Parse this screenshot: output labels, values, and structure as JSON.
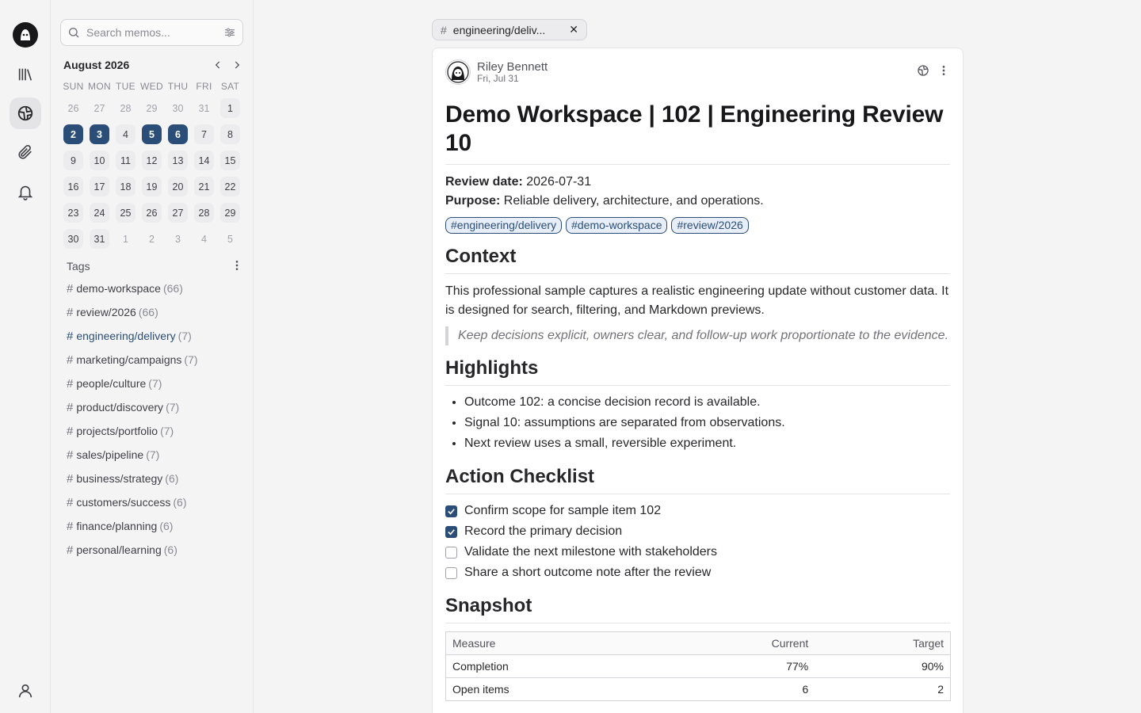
{
  "search": {
    "placeholder": "Search memos..."
  },
  "calendar": {
    "month_label": "August 2026",
    "weekdays": [
      "SUN",
      "MON",
      "TUE",
      "WED",
      "THU",
      "FRI",
      "SAT"
    ],
    "days": [
      {
        "d": "26",
        "muted": true
      },
      {
        "d": "27",
        "muted": true
      },
      {
        "d": "28",
        "muted": true
      },
      {
        "d": "29",
        "muted": true
      },
      {
        "d": "30",
        "muted": true
      },
      {
        "d": "31",
        "muted": true
      },
      {
        "d": "1",
        "bg": true
      },
      {
        "d": "2",
        "sel": true
      },
      {
        "d": "3",
        "sel": true
      },
      {
        "d": "4",
        "bg": true
      },
      {
        "d": "5",
        "sel": true
      },
      {
        "d": "6",
        "sel": true
      },
      {
        "d": "7",
        "bg": true
      },
      {
        "d": "8",
        "bg": true
      },
      {
        "d": "9",
        "bg": true
      },
      {
        "d": "10",
        "bg": true
      },
      {
        "d": "11",
        "bg": true
      },
      {
        "d": "12",
        "bg": true
      },
      {
        "d": "13",
        "bg": true
      },
      {
        "d": "14",
        "bg": true
      },
      {
        "d": "15",
        "bg": true
      },
      {
        "d": "16",
        "bg": true
      },
      {
        "d": "17",
        "bg": true
      },
      {
        "d": "18",
        "bg": true
      },
      {
        "d": "19",
        "bg": true
      },
      {
        "d": "20",
        "bg": true
      },
      {
        "d": "21",
        "bg": true
      },
      {
        "d": "22",
        "bg": true
      },
      {
        "d": "23",
        "bg": true
      },
      {
        "d": "24",
        "bg": true
      },
      {
        "d": "25",
        "bg": true
      },
      {
        "d": "26",
        "bg": true
      },
      {
        "d": "27",
        "bg": true
      },
      {
        "d": "28",
        "bg": true
      },
      {
        "d": "29",
        "bg": true
      },
      {
        "d": "30",
        "bg": true
      },
      {
        "d": "31",
        "bg": true
      },
      {
        "d": "1",
        "muted": true
      },
      {
        "d": "2",
        "muted": true
      },
      {
        "d": "3",
        "muted": true
      },
      {
        "d": "4",
        "muted": true
      },
      {
        "d": "5",
        "muted": true
      }
    ]
  },
  "tags": {
    "heading": "Tags",
    "items": [
      {
        "name": "demo-workspace",
        "count": "(66)"
      },
      {
        "name": "review/2026",
        "count": "(66)"
      },
      {
        "name": "engineering/delivery",
        "count": "(7)",
        "active": true
      },
      {
        "name": "marketing/campaigns",
        "count": "(7)"
      },
      {
        "name": "people/culture",
        "count": "(7)"
      },
      {
        "name": "product/discovery",
        "count": "(7)"
      },
      {
        "name": "projects/portfolio",
        "count": "(7)"
      },
      {
        "name": "sales/pipeline",
        "count": "(7)"
      },
      {
        "name": "business/strategy",
        "count": "(6)"
      },
      {
        "name": "customers/success",
        "count": "(6)"
      },
      {
        "name": "finance/planning",
        "count": "(6)"
      },
      {
        "name": "personal/learning",
        "count": "(6)"
      }
    ]
  },
  "filter": {
    "label": "engineering/deliv...",
    "close": "✕"
  },
  "memo": {
    "author": "Riley Bennett",
    "date": "Fri, Jul 31",
    "title": "Demo Workspace | 102 | Engineering Review 10",
    "review_label": "Review date:",
    "review_value": " 2026-07-31",
    "purpose_label": "Purpose:",
    "purpose_value": " Reliable delivery, architecture, and operations.",
    "tag_pills": [
      "#engineering/delivery",
      "#demo-workspace",
      "#review/2026"
    ],
    "context_heading": "Context",
    "context_text": "This professional sample captures a realistic engineering update without customer data. It is designed for search, filtering, and Markdown previews.",
    "quote": "Keep decisions explicit, owners clear, and follow-up work proportionate to the evidence.",
    "highlights_heading": "Highlights",
    "highlights": [
      "Outcome 102: a concise decision record is available.",
      "Signal 10: assumptions are separated from observations.",
      "Next review uses a small, reversible experiment."
    ],
    "checklist_heading": "Action Checklist",
    "checklist": [
      {
        "text": "Confirm scope for sample item 102",
        "done": true
      },
      {
        "text": "Record the primary decision",
        "done": true
      },
      {
        "text": "Validate the next milestone with stakeholders",
        "done": false
      },
      {
        "text": "Share a short outcome note after the review",
        "done": false
      }
    ],
    "snapshot_heading": "Snapshot",
    "table": {
      "headers": [
        "Measure",
        "Current",
        "Target"
      ],
      "rows": [
        [
          "Completion",
          "77%",
          "90%"
        ],
        [
          "Open items",
          "6",
          "2"
        ]
      ]
    }
  },
  "colors": {
    "accent": "#2a4e78",
    "background": "#f4f4f5",
    "card": "#ffffff"
  },
  "icons": {
    "rail": [
      "logo-icon",
      "library-icon",
      "explore-icon",
      "paperclip-icon",
      "bell-icon",
      "user-icon"
    ]
  }
}
